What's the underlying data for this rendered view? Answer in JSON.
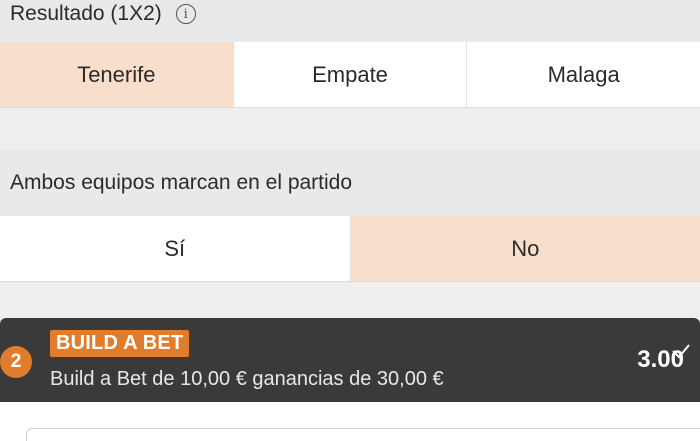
{
  "resultado": {
    "title": "Resultado (1X2)",
    "info_icon": "info-icon",
    "options": [
      {
        "label": "Tenerife",
        "selected": true
      },
      {
        "label": "Empate",
        "selected": false
      },
      {
        "label": "Malaga",
        "selected": false
      }
    ]
  },
  "ambos": {
    "title": "Ambos equipos marcan en el partido",
    "options": [
      {
        "label": "Sí",
        "selected": false
      },
      {
        "label": "No",
        "selected": true
      }
    ]
  },
  "betslip": {
    "count": "2",
    "tag": "BUILD A BET",
    "description": "Build a Bet de 10,00 € ganancias de 30,00 €",
    "odds": "3.00",
    "check_icon": "checkmark-icon",
    "accent_color": "#e07d2c",
    "selected_color": "#f8dfcb"
  }
}
